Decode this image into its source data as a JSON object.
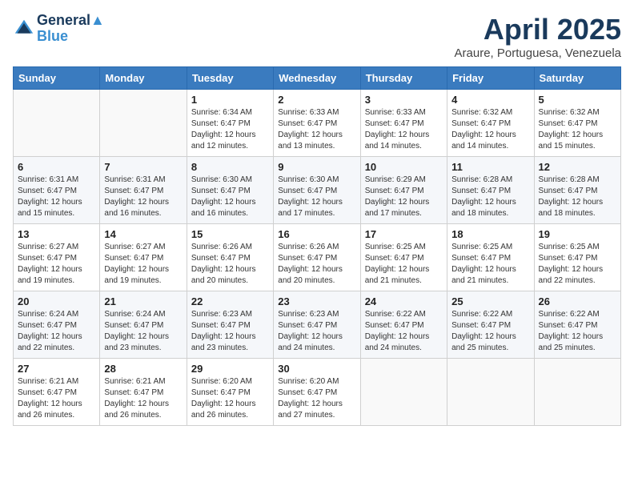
{
  "header": {
    "logo_line1": "General",
    "logo_line2": "Blue",
    "month_title": "April 2025",
    "subtitle": "Araure, Portuguesa, Venezuela"
  },
  "weekdays": [
    "Sunday",
    "Monday",
    "Tuesday",
    "Wednesday",
    "Thursday",
    "Friday",
    "Saturday"
  ],
  "weeks": [
    [
      {
        "day": "",
        "info": ""
      },
      {
        "day": "",
        "info": ""
      },
      {
        "day": "1",
        "info": "Sunrise: 6:34 AM\nSunset: 6:47 PM\nDaylight: 12 hours and 12 minutes."
      },
      {
        "day": "2",
        "info": "Sunrise: 6:33 AM\nSunset: 6:47 PM\nDaylight: 12 hours and 13 minutes."
      },
      {
        "day": "3",
        "info": "Sunrise: 6:33 AM\nSunset: 6:47 PM\nDaylight: 12 hours and 14 minutes."
      },
      {
        "day": "4",
        "info": "Sunrise: 6:32 AM\nSunset: 6:47 PM\nDaylight: 12 hours and 14 minutes."
      },
      {
        "day": "5",
        "info": "Sunrise: 6:32 AM\nSunset: 6:47 PM\nDaylight: 12 hours and 15 minutes."
      }
    ],
    [
      {
        "day": "6",
        "info": "Sunrise: 6:31 AM\nSunset: 6:47 PM\nDaylight: 12 hours and 15 minutes."
      },
      {
        "day": "7",
        "info": "Sunrise: 6:31 AM\nSunset: 6:47 PM\nDaylight: 12 hours and 16 minutes."
      },
      {
        "day": "8",
        "info": "Sunrise: 6:30 AM\nSunset: 6:47 PM\nDaylight: 12 hours and 16 minutes."
      },
      {
        "day": "9",
        "info": "Sunrise: 6:30 AM\nSunset: 6:47 PM\nDaylight: 12 hours and 17 minutes."
      },
      {
        "day": "10",
        "info": "Sunrise: 6:29 AM\nSunset: 6:47 PM\nDaylight: 12 hours and 17 minutes."
      },
      {
        "day": "11",
        "info": "Sunrise: 6:28 AM\nSunset: 6:47 PM\nDaylight: 12 hours and 18 minutes."
      },
      {
        "day": "12",
        "info": "Sunrise: 6:28 AM\nSunset: 6:47 PM\nDaylight: 12 hours and 18 minutes."
      }
    ],
    [
      {
        "day": "13",
        "info": "Sunrise: 6:27 AM\nSunset: 6:47 PM\nDaylight: 12 hours and 19 minutes."
      },
      {
        "day": "14",
        "info": "Sunrise: 6:27 AM\nSunset: 6:47 PM\nDaylight: 12 hours and 19 minutes."
      },
      {
        "day": "15",
        "info": "Sunrise: 6:26 AM\nSunset: 6:47 PM\nDaylight: 12 hours and 20 minutes."
      },
      {
        "day": "16",
        "info": "Sunrise: 6:26 AM\nSunset: 6:47 PM\nDaylight: 12 hours and 20 minutes."
      },
      {
        "day": "17",
        "info": "Sunrise: 6:25 AM\nSunset: 6:47 PM\nDaylight: 12 hours and 21 minutes."
      },
      {
        "day": "18",
        "info": "Sunrise: 6:25 AM\nSunset: 6:47 PM\nDaylight: 12 hours and 21 minutes."
      },
      {
        "day": "19",
        "info": "Sunrise: 6:25 AM\nSunset: 6:47 PM\nDaylight: 12 hours and 22 minutes."
      }
    ],
    [
      {
        "day": "20",
        "info": "Sunrise: 6:24 AM\nSunset: 6:47 PM\nDaylight: 12 hours and 22 minutes."
      },
      {
        "day": "21",
        "info": "Sunrise: 6:24 AM\nSunset: 6:47 PM\nDaylight: 12 hours and 23 minutes."
      },
      {
        "day": "22",
        "info": "Sunrise: 6:23 AM\nSunset: 6:47 PM\nDaylight: 12 hours and 23 minutes."
      },
      {
        "day": "23",
        "info": "Sunrise: 6:23 AM\nSunset: 6:47 PM\nDaylight: 12 hours and 24 minutes."
      },
      {
        "day": "24",
        "info": "Sunrise: 6:22 AM\nSunset: 6:47 PM\nDaylight: 12 hours and 24 minutes."
      },
      {
        "day": "25",
        "info": "Sunrise: 6:22 AM\nSunset: 6:47 PM\nDaylight: 12 hours and 25 minutes."
      },
      {
        "day": "26",
        "info": "Sunrise: 6:22 AM\nSunset: 6:47 PM\nDaylight: 12 hours and 25 minutes."
      }
    ],
    [
      {
        "day": "27",
        "info": "Sunrise: 6:21 AM\nSunset: 6:47 PM\nDaylight: 12 hours and 26 minutes."
      },
      {
        "day": "28",
        "info": "Sunrise: 6:21 AM\nSunset: 6:47 PM\nDaylight: 12 hours and 26 minutes."
      },
      {
        "day": "29",
        "info": "Sunrise: 6:20 AM\nSunset: 6:47 PM\nDaylight: 12 hours and 26 minutes."
      },
      {
        "day": "30",
        "info": "Sunrise: 6:20 AM\nSunset: 6:47 PM\nDaylight: 12 hours and 27 minutes."
      },
      {
        "day": "",
        "info": ""
      },
      {
        "day": "",
        "info": ""
      },
      {
        "day": "",
        "info": ""
      }
    ]
  ]
}
